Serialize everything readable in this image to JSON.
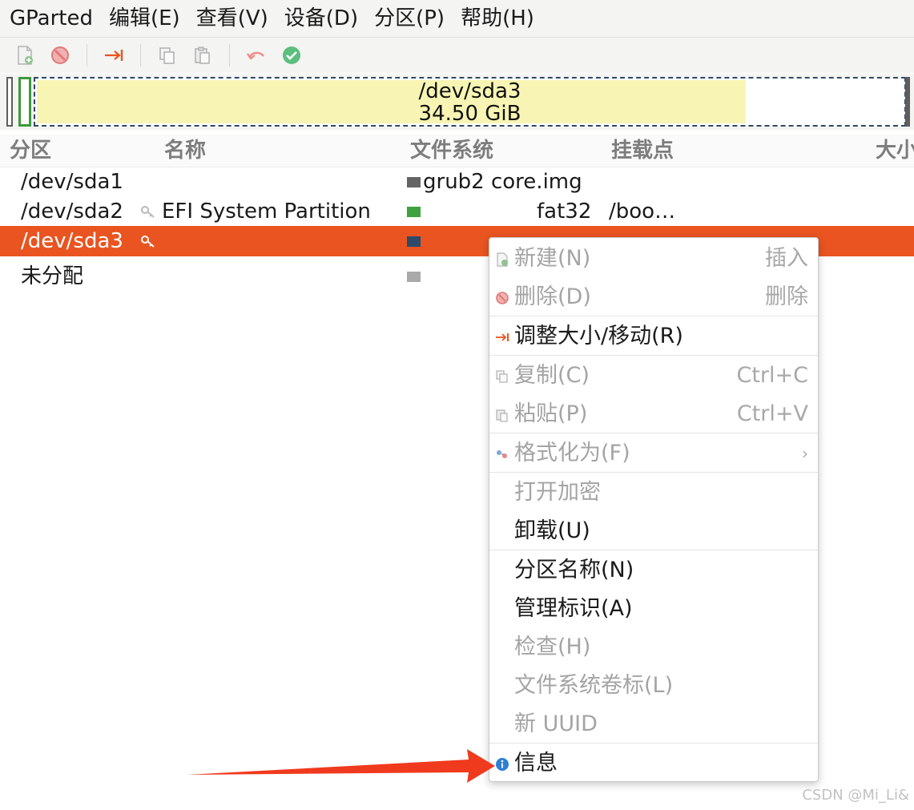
{
  "menubar": {
    "items": [
      "GParted",
      "编辑(E)",
      "查看(V)",
      "设备(D)",
      "分区(P)",
      "帮助(H)"
    ]
  },
  "toolbar": {
    "buttons": [
      "new-icon",
      "delete-icon",
      "resize-icon",
      "copy-icon",
      "paste-icon",
      "undo-icon",
      "apply-icon"
    ]
  },
  "diskmap": {
    "selected_device": "/dev/sda3",
    "selected_size": "34.50 GiB"
  },
  "table": {
    "headers": [
      "分区",
      "名称",
      "文件系统",
      "挂载点",
      "大小"
    ],
    "rows": [
      {
        "partition": "/dev/sda1",
        "name": "",
        "filesystem": "grub2 core.img",
        "mount": "",
        "color": "#646464",
        "locked": false,
        "selected": false
      },
      {
        "partition": "/dev/sda2",
        "name": "EFI System Partition",
        "filesystem": "fat32",
        "mount": "/boo…",
        "color": "#3ea33e",
        "locked": true,
        "selected": false
      },
      {
        "partition": "/dev/sda3",
        "name": "",
        "filesystem": "",
        "mount": "",
        "color": "#2d4a6b",
        "locked": true,
        "selected": true
      },
      {
        "partition": "未分配",
        "name": "",
        "filesystem": "",
        "mount": "",
        "color": "#a9a9a9",
        "locked": false,
        "selected": false
      }
    ]
  },
  "context_menu": {
    "items": [
      {
        "label": "新建(N)",
        "accel": "插入",
        "disabled": true,
        "icon": "new-icon"
      },
      {
        "label": "删除(D)",
        "accel": "删除",
        "disabled": true,
        "icon": "delete-icon"
      },
      {
        "label": "调整大小/移动(R)",
        "accel": "",
        "disabled": false,
        "icon": "resize-icon"
      },
      {
        "label": "复制(C)",
        "accel": "Ctrl+C",
        "disabled": true,
        "icon": "copy-icon"
      },
      {
        "label": "粘贴(P)",
        "accel": "Ctrl+V",
        "disabled": true,
        "icon": "paste-icon"
      },
      {
        "label": "格式化为(F)",
        "accel": "›",
        "disabled": true,
        "icon": "format-icon"
      },
      {
        "label": "打开加密",
        "accel": "",
        "disabled": true,
        "icon": ""
      },
      {
        "label": "卸载(U)",
        "accel": "",
        "disabled": false,
        "icon": ""
      },
      {
        "label": "分区名称(N)",
        "accel": "",
        "disabled": false,
        "icon": ""
      },
      {
        "label": "管理标识(A)",
        "accel": "",
        "disabled": false,
        "icon": ""
      },
      {
        "label": "检查(H)",
        "accel": "",
        "disabled": true,
        "icon": ""
      },
      {
        "label": "文件系统卷标(L)",
        "accel": "",
        "disabled": true,
        "icon": ""
      },
      {
        "label": "新 UUID",
        "accel": "",
        "disabled": true,
        "icon": ""
      },
      {
        "label": "信息",
        "accel": "",
        "disabled": false,
        "icon": "info-icon"
      }
    ]
  },
  "watermark": "CSDN @Mi_Li&",
  "colors": {
    "accent": "#e95420",
    "used_space": "#f8f5b4",
    "arrow": "#f03a1e"
  }
}
